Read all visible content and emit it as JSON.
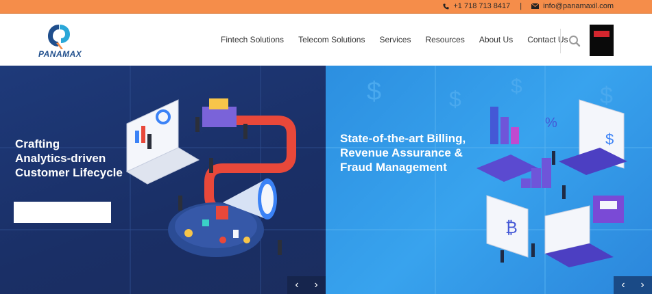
{
  "topbar": {
    "phone_icon": "phone-icon",
    "phone": "+1 718 713 8417",
    "separator": "|",
    "email_icon": "envelope-icon",
    "email": "info@panamaxil.com"
  },
  "header": {
    "logo_text": "PANAMAX",
    "nav": [
      "Fintech Solutions",
      "Telecom Solutions",
      "Services",
      "Resources",
      "About Us",
      "Contact Us"
    ],
    "search_icon": "search-icon"
  },
  "slides": [
    {
      "title_lines": [
        "Crafting",
        "Analytics-driven",
        "Customer Lifecycle"
      ],
      "cta_label": ""
    },
    {
      "title_lines": [
        "State-of-the-art Billing,",
        "Revenue Assurance &",
        "Fraud Management"
      ]
    }
  ],
  "controls": {
    "prev": "‹",
    "next": "›"
  },
  "colors": {
    "topbar": "#f58d4a",
    "brand_blue": "#1f4e8c",
    "left_slide": "#1e3a7a",
    "right_slide": "#2c8fe0"
  }
}
